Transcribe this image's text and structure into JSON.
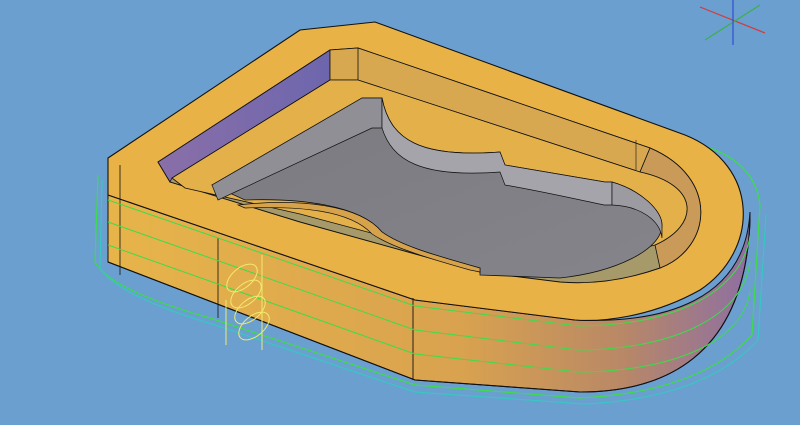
{
  "viewport": {
    "background_color": "#6a9fcf",
    "scene": "3d-shaded-pocket-part-with-toolpaths"
  },
  "part": {
    "top_face_color": "#e8b246",
    "side_face_color": "#e3ad49",
    "side_gradient_end_color": "#8e6fa3",
    "inner_wall_color": "#7b6aa8",
    "pocket_floor_color": "#7d7d84",
    "pocket_wall_color": "#9a9aa0",
    "edge_color": "#111111"
  },
  "toolpaths": {
    "contour_color": "#3ddc4a",
    "helix_color": "#f1ea6d"
  },
  "axis_triad": {
    "icon": "axis-triad-icon",
    "x_color": "#d23b3b",
    "y_color": "#39b24a",
    "z_color": "#2f4fd6"
  }
}
